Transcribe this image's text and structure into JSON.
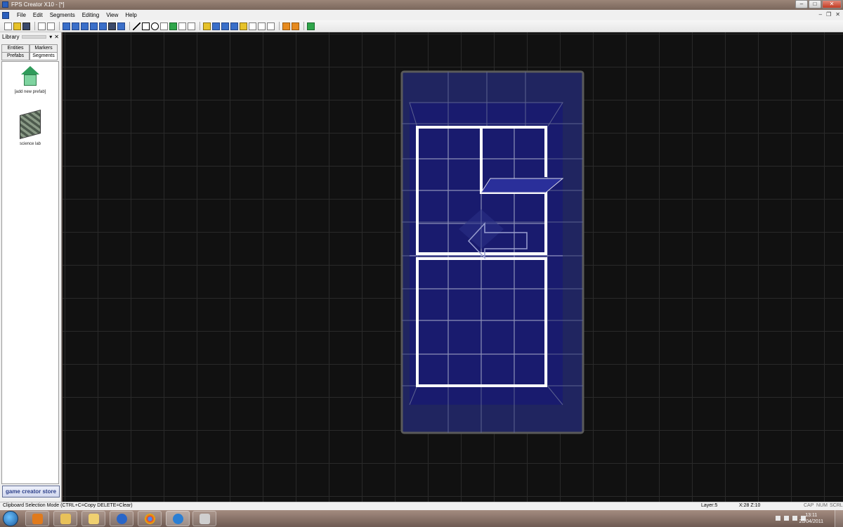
{
  "window": {
    "title": "FPS Creator X10 - [*]"
  },
  "menu": {
    "items": [
      "File",
      "Edit",
      "Segments",
      "Editing",
      "View",
      "Help"
    ]
  },
  "library": {
    "header_label": "Library",
    "tabs": {
      "entities": "Entities",
      "markers": "Markers",
      "prefabs": "Prefabs",
      "segments": "Segments"
    },
    "items": [
      {
        "label": "[add new prefab]",
        "icon": "house-icon"
      },
      {
        "label": "science lab",
        "icon": "science-lab-thumbnail"
      }
    ],
    "store_button": "game creator store"
  },
  "status": {
    "mode": "Clipboard Selection Mode (CTRL+C=Copy DELETE=Clear)",
    "layer": "Layer:5",
    "coords": "X:28  Z:10",
    "cap": "CAP",
    "num": "NUM",
    "scrl": "SCRL"
  },
  "taskbar": {
    "time": "13:11",
    "date": "20/04/2011"
  },
  "colors": {
    "floor": "#17185a",
    "wall": "#ffffff",
    "grid": "#2a2a2a",
    "viewport_bg": "#111111"
  }
}
